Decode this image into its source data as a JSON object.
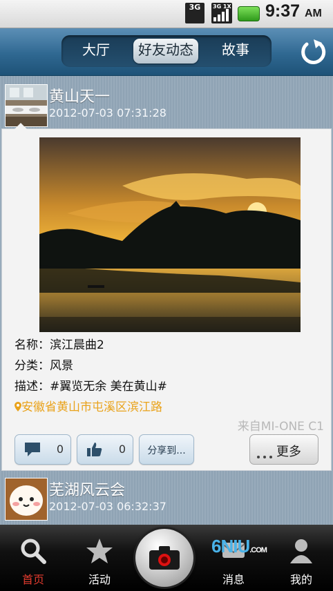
{
  "status_bar": {
    "network_badge": "3G",
    "signal_badge": "3G 1X",
    "time": "9:37",
    "ampm": "AM",
    "icons": [
      "network-3g-icon",
      "signal-icon",
      "battery-icon"
    ]
  },
  "header": {
    "tabs": [
      {
        "label": "大厅",
        "active": false
      },
      {
        "label": "好友动态",
        "active": true
      },
      {
        "label": "故事",
        "active": false
      }
    ],
    "refresh_icon": "refresh-icon"
  },
  "posts": [
    {
      "user": "黄山天一",
      "time": "2012-07-03 07:31:28",
      "info": [
        {
          "text": "名称：滨江晨曲2"
        },
        {
          "text": "分类：风景"
        },
        {
          "text": "描述：#翼览无余 美在黄山#"
        }
      ],
      "location": "安徽省黄山市屯溪区滨江路",
      "source": "来自MI-ONE C1",
      "comment_count": "0",
      "like_count": "0",
      "share_label": "分享到...",
      "more_label": "更多"
    },
    {
      "user": "芜湖风云会",
      "time": "2012-07-03 06:32:37"
    }
  ],
  "bottom_nav": {
    "items": [
      {
        "label": "首页",
        "icon": "search-icon",
        "active": true
      },
      {
        "label": "活动",
        "icon": "star-icon",
        "active": false
      },
      {
        "label": "",
        "icon": "camera-icon",
        "active": false
      },
      {
        "label": "消息",
        "icon": "message-icon",
        "active": false
      },
      {
        "label": "我的",
        "icon": "person-icon",
        "active": false
      }
    ]
  },
  "watermark": {
    "text": "6NIU",
    "sub": ".COM"
  },
  "colors": {
    "accent": "#2f6891",
    "active_nav": "#e23b2e",
    "location": "#e9a21a"
  }
}
